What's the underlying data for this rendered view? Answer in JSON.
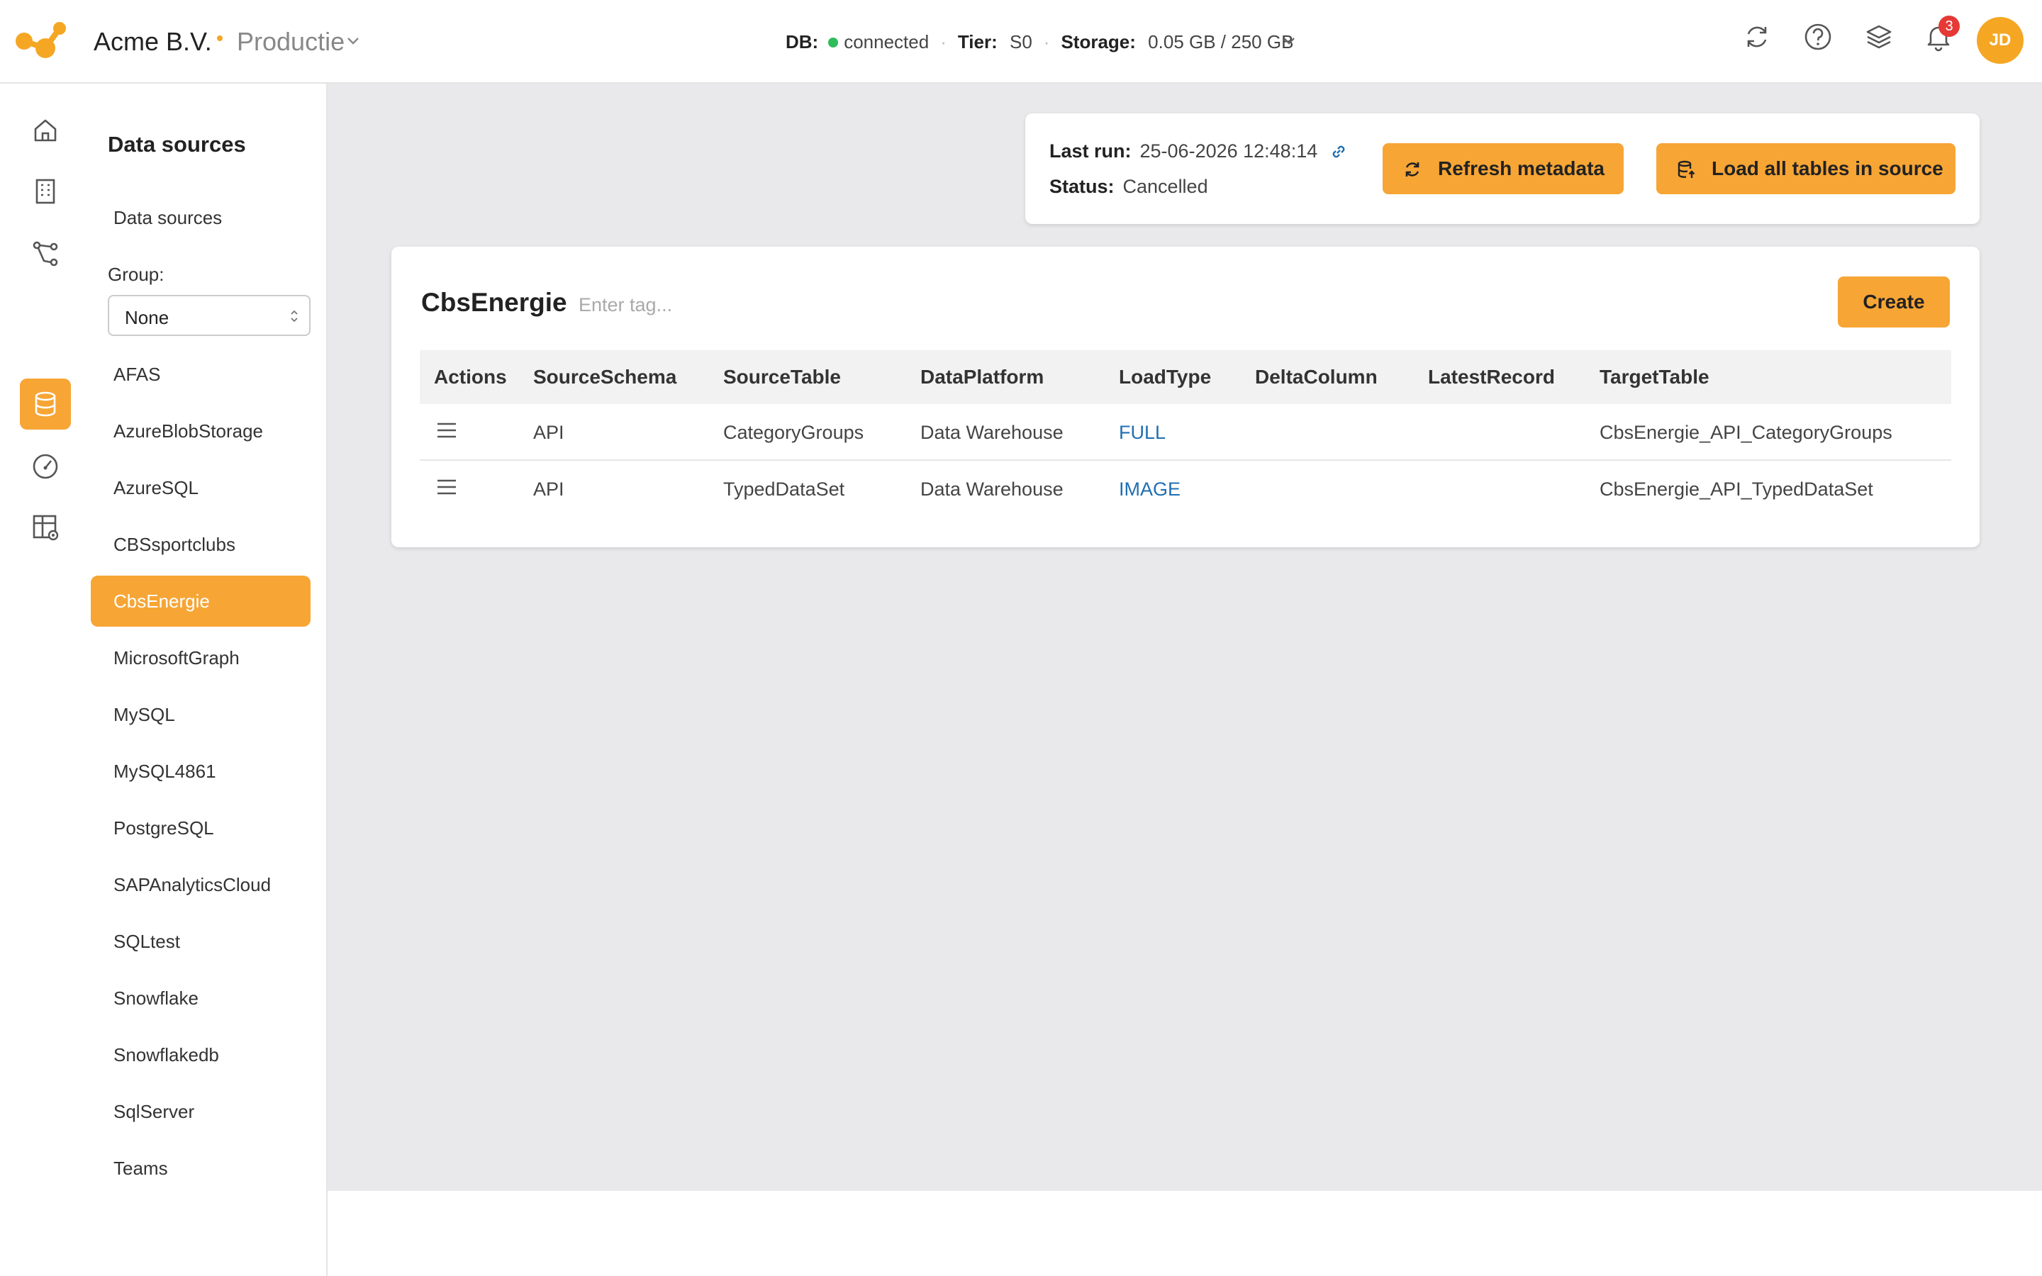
{
  "header": {
    "company": "Acme B.V.",
    "environment": "Productie",
    "db_label": "DB:",
    "db_status": "connected",
    "tier_label": "Tier:",
    "tier_value": "S0",
    "storage_label": "Storage:",
    "storage_value": "0.05 GB / 250 GB",
    "notifications_count": "3",
    "avatar_initials": "JD",
    "icons": [
      "refresh-icon",
      "help-icon",
      "layers-icon",
      "bell-icon"
    ]
  },
  "rail": {
    "icons": [
      "home-icon",
      "building-icon",
      "pipeline-icon",
      "database-icon",
      "gauge-icon",
      "table-settings-icon"
    ],
    "active": "database-icon"
  },
  "sidebar": {
    "title": "Data sources",
    "link": "Data sources",
    "group_label": "Group:",
    "group_value": "None",
    "items": [
      {
        "label": "AFAS"
      },
      {
        "label": "AzureBlobStorage"
      },
      {
        "label": "AzureSQL"
      },
      {
        "label": "CBSsportclubs"
      },
      {
        "label": "CbsEnergie"
      },
      {
        "label": "MicrosoftGraph"
      },
      {
        "label": "MySQL"
      },
      {
        "label": "MySQL4861"
      },
      {
        "label": "PostgreSQL"
      },
      {
        "label": "SAPAnalyticsCloud"
      },
      {
        "label": "SQLtest"
      },
      {
        "label": "Snowflake"
      },
      {
        "label": "Snowflakedb"
      },
      {
        "label": "SqlServer"
      },
      {
        "label": "Teams"
      }
    ],
    "active_item": "CbsEnergie"
  },
  "run": {
    "last_run_label": "Last run:",
    "last_run_value": "25-06-2026 12:48:14",
    "status_label": "Status:",
    "status_value": "Cancelled",
    "refresh_button": "Refresh metadata",
    "load_button": "Load all tables in source"
  },
  "source": {
    "name": "CbsEnergie",
    "tag_placeholder": "Enter tag...",
    "create_button": "Create",
    "columns": [
      "Actions",
      "SourceSchema",
      "SourceTable",
      "DataPlatform",
      "LoadType",
      "DeltaColumn",
      "LatestRecord",
      "TargetTable"
    ],
    "rows": [
      {
        "schema": "API",
        "table": "CategoryGroups",
        "platform": "Data Warehouse",
        "loadtype": "FULL",
        "delta": "",
        "latest": "",
        "target": "CbsEnergie_API_CategoryGroups"
      },
      {
        "schema": "API",
        "table": "TypedDataSet",
        "platform": "Data Warehouse",
        "loadtype": "IMAGE",
        "delta": "",
        "latest": "",
        "target": "CbsEnergie_API_TypedDataSet"
      }
    ]
  },
  "colors": {
    "accent": "#f7a535",
    "link": "#1f6fb2",
    "status_connected": "#2ebd59",
    "badge": "#e53935",
    "main_bg": "#e9e9eb"
  }
}
